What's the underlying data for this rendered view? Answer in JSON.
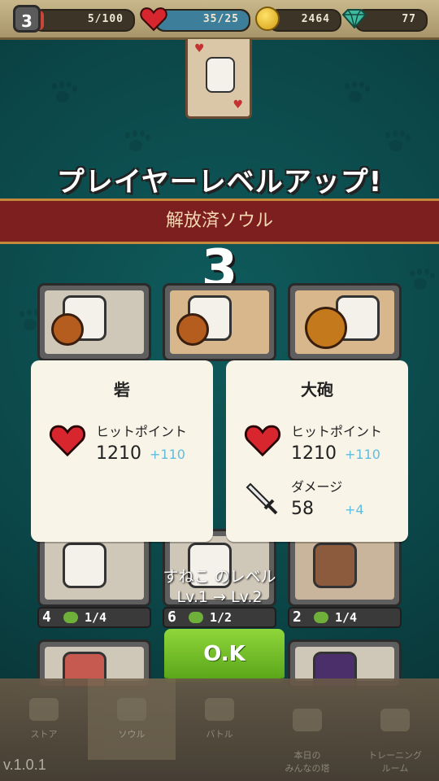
{
  "hud": {
    "player_level": "3",
    "exp": "5/100",
    "stamina": "35/25",
    "coins": "2464",
    "gems": "77"
  },
  "levelup": {
    "title": "プレイヤーレベルアップ!",
    "banner": "解放済ソウル",
    "souls_count": "3"
  },
  "units": {
    "row2": [
      {
        "lv": "4",
        "count": "1/4"
      },
      {
        "lv": "6",
        "count": "1/2"
      },
      {
        "lv": "2",
        "count": "1/4"
      }
    ]
  },
  "popups": [
    {
      "name": "砦",
      "hp_label": "ヒットポイント",
      "hp_value": "1210",
      "hp_plus": "+110"
    },
    {
      "name": "大砲",
      "hp_label": "ヒットポイント",
      "hp_value": "1210",
      "hp_plus": "+110",
      "dmg_label": "ダメージ",
      "dmg_value": "58",
      "dmg_plus": "+4"
    }
  ],
  "level_change": {
    "line1": "すねこ のレベル",
    "line2": "Lv.1 → Lv.2"
  },
  "ok_label": "O.K",
  "tabs": [
    {
      "label": "ストア"
    },
    {
      "label": "ソウル"
    },
    {
      "label": "バトル"
    },
    {
      "label": "本日の\nみんなの塔"
    },
    {
      "label": "トレーニング\nルーム"
    }
  ],
  "version": "v.1.0.1",
  "colors": {
    "ok_green": "#6dbb22",
    "banner_red": "#7d1f1f",
    "plus_blue": "#5fbde0",
    "popup_bg": "#f8f4e8"
  }
}
